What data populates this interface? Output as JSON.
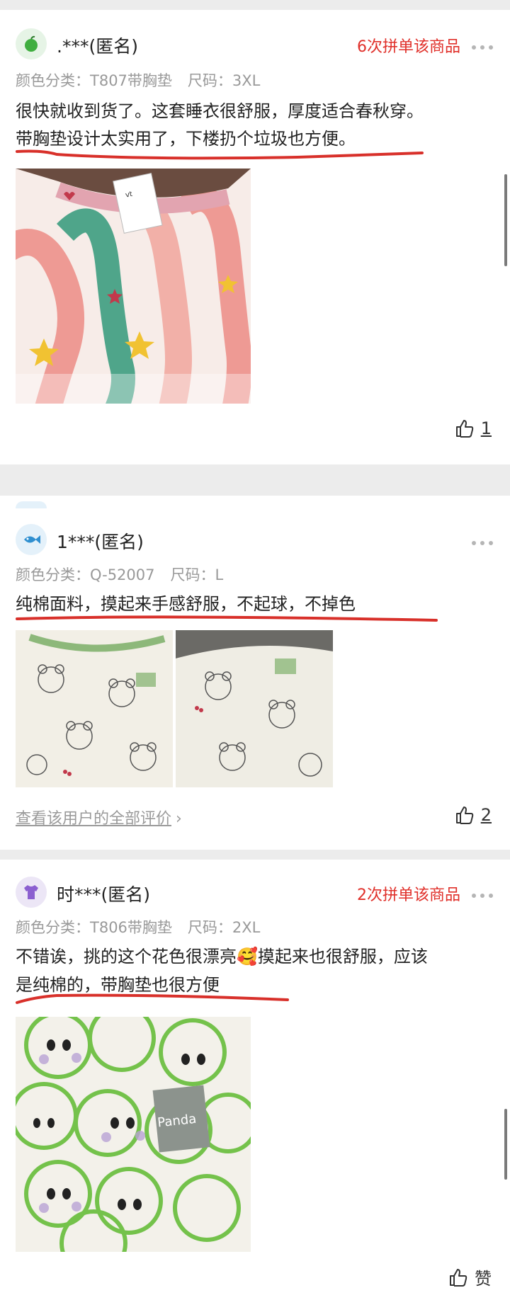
{
  "reviews": [
    {
      "username": ".***(匿名)",
      "group_badge": "6次拼单该商品",
      "spec_color_label": "颜色分类：",
      "spec_color_value": "T807带胸垫",
      "spec_size_label": "尺码：",
      "spec_size_value": "3XL",
      "text_lines": [
        "很快就收到货了。这套睡衣很舒服，厚度适合春秋穿。",
        "带胸垫设计太实用了，下楼扔个垃圾也方便。"
      ],
      "likes": "1",
      "avatar_icon": "apple-icon",
      "avatar_color": "#e6f4e6"
    },
    {
      "username": "1***(匿名)",
      "spec_color_label": "颜色分类：",
      "spec_color_value": "Q-52007",
      "spec_size_label": "尺码：",
      "spec_size_value": "L",
      "text_lines": [
        "纯棉面料，摸起来手感舒服，不起球，不掉色"
      ],
      "view_all": "查看该用户的全部评价",
      "likes": "2",
      "avatar_icon": "fish-icon",
      "avatar_color": "#e4f1fa"
    },
    {
      "username": "时***(匿名)",
      "group_badge": "2次拼单该商品",
      "spec_color_label": "颜色分类：",
      "spec_color_value": "T806带胸垫",
      "spec_size_label": "尺码：",
      "spec_size_value": "2XL",
      "text_lines": [
        "不错诶，挑的这个花色很漂亮🥰摸起来也很舒服，应该",
        "是纯棉的，带胸垫也很方便"
      ],
      "likes": "赞",
      "avatar_icon": "tshirt-icon",
      "avatar_color": "#ece6f6"
    }
  ],
  "photo_texts": {
    "tag": "vt",
    "panda": "Panda"
  },
  "colors": {
    "accent_red": "#e0302a",
    "underline_red": "#d8302a"
  }
}
